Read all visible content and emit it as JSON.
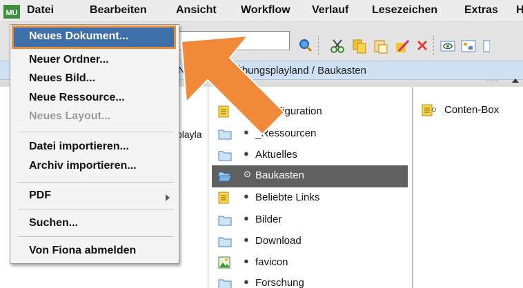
{
  "menubar": {
    "logo_text": "MU",
    "items": [
      "Datei",
      "Bearbeiten",
      "Ansicht",
      "Workflow",
      "Verlauf",
      "Lesezeichen",
      "Extras",
      "H"
    ]
  },
  "breadcrumb": {
    "prefix": "Ne",
    "text": "Übungsplayland / Baukasten"
  },
  "left_pane": {
    "partial_text": "playla"
  },
  "dropdown": {
    "items": [
      {
        "label": "Neues Dokument...",
        "disabled": false,
        "highlighted": true
      },
      {
        "label": "Neuer Ordner...",
        "disabled": false
      },
      {
        "label": "Neues Bild...",
        "disabled": false
      },
      {
        "label": "Neue Ressource...",
        "disabled": false
      },
      {
        "label": "Neues Layout...",
        "disabled": true
      },
      {
        "label": "Datei importieren...",
        "disabled": false
      },
      {
        "label": "Archiv importieren...",
        "disabled": false
      },
      {
        "label": "PDF",
        "disabled": false,
        "submenu": true
      },
      {
        "label": "Suchen...",
        "disabled": false
      },
      {
        "label": "Von Fiona abmelden",
        "disabled": false
      }
    ]
  },
  "folder_list": [
    {
      "label": "_Konfiguration",
      "icon": "document-icon",
      "selected": false
    },
    {
      "label": "_Ressourcen",
      "icon": "folder-icon",
      "selected": false
    },
    {
      "label": "Aktuelles",
      "icon": "folder-icon",
      "selected": false
    },
    {
      "label": "Baukasten",
      "icon": "folder-open-icon",
      "selected": true
    },
    {
      "label": "Beliebte Links",
      "icon": "document-icon",
      "selected": false
    },
    {
      "label": "Bilder",
      "icon": "folder-icon",
      "selected": false
    },
    {
      "label": "Download",
      "icon": "folder-icon",
      "selected": false
    },
    {
      "label": "favicon",
      "icon": "image-icon",
      "selected": false
    },
    {
      "label": "Forschung",
      "icon": "folder-icon",
      "selected": false
    }
  ],
  "right_pane": {
    "items": [
      {
        "label": "Conten-Box",
        "icon": "document-icon"
      }
    ]
  },
  "colors": {
    "highlight_fill": "#3d6fa9",
    "highlight_border": "#ee8a3c",
    "arrow": "#f08a3a",
    "selected_row": "#5f5f5f",
    "breadcrumb_bar": "#cfe0f4"
  }
}
